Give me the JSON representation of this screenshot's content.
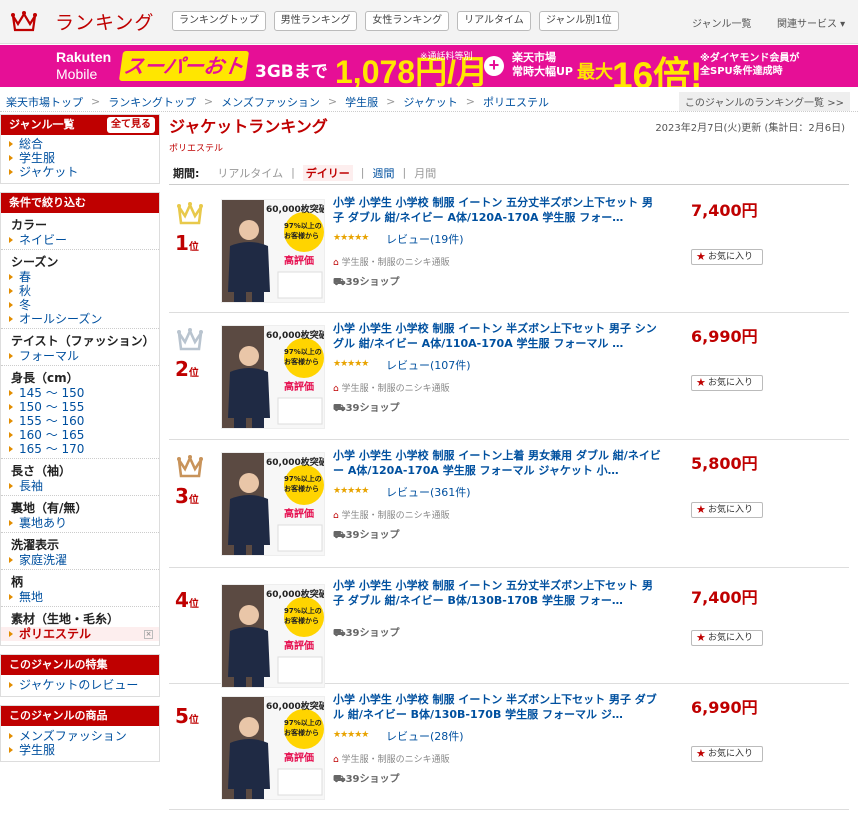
{
  "header": {
    "title": "ランキング",
    "nav": [
      "ランキングトップ",
      "男性ランキング",
      "女性ランキング",
      "リアルタイム",
      "ジャンル別1位"
    ],
    "genre_list": "ジャンル一覧",
    "services": "関連サービス ▾"
  },
  "banner": {
    "brand": "Rakuten",
    "brand2": "Mobile",
    "campaign": "スーパーおトク",
    "data": "3GBまで",
    "price": "1,078円/月",
    "note": "※通話料等別",
    "ichiba1": "楽天市場",
    "ichiba2": "常時大幅UP",
    "max": "最大",
    "mult": "16倍!",
    "dia1": "※ダイヤモンド会員が",
    "dia2": "全SPU条件達成時"
  },
  "breadcrumb": {
    "items": [
      "楽天市場トップ",
      "ランキングトップ",
      "メンズファッション",
      "学生服",
      "ジャケット",
      "ポリエステル"
    ],
    "list_link": "このジャンルのランキング一覧 >>"
  },
  "sidebar": {
    "genre_head": "ジャンル一覧",
    "all_button": "全て見る",
    "genres": [
      "総合",
      "学生服",
      "ジャケット"
    ],
    "filter_head": "条件で絞り込む",
    "filters": [
      {
        "name": "カラー",
        "items": [
          "ネイビー"
        ]
      },
      {
        "name": "シーズン",
        "items": [
          "春",
          "秋",
          "冬",
          "オールシーズン"
        ]
      },
      {
        "name": "テイスト（ファッション）",
        "items": [
          "フォーマル"
        ]
      },
      {
        "name": "身長（cm）",
        "items": [
          "145 ～ 150",
          "150 ～ 155",
          "155 ～ 160",
          "160 ～ 165",
          "165 ～ 170"
        ]
      },
      {
        "name": "長さ（袖）",
        "items": [
          "長袖"
        ]
      },
      {
        "name": "裏地（有/無）",
        "items": [
          "裏地あり"
        ]
      },
      {
        "name": "洗濯表示",
        "items": [
          "家庭洗濯"
        ]
      },
      {
        "name": "柄",
        "items": [
          "無地"
        ]
      },
      {
        "name": "素材（生地・毛糸）",
        "items": [
          "ポリエステル"
        ]
      }
    ],
    "feature_head": "このジャンルの特集",
    "feature": "ジャケットのレビュー",
    "products_head": "このジャンルの商品",
    "products": [
      "メンズファッション",
      "学生服"
    ]
  },
  "main": {
    "title": "ジャケットランキング",
    "subtitle": "ポリエステル",
    "updated": "2023年2月7日(火)更新 (集計日：2月6日)",
    "period_label": "期間:",
    "periods": [
      "リアルタイム",
      "デイリー",
      "週間",
      "月間"
    ],
    "current_period": "デイリー"
  },
  "items": [
    {
      "rank": "1",
      "rank_unit": "位",
      "title": "小学 小学生 小学校 制服 イートン 五分丈半ズボン上下セット 男子 ダブル 紺/ネイビー A体/120A-170A 学生服 フォー…",
      "price": "7,400円",
      "reviews": "レビュー(19件)",
      "shop": "学生服・制服のニシキ通販",
      "ship": "39ショップ",
      "fav": "お気に入り",
      "color": "#e8c94b"
    },
    {
      "rank": "2",
      "rank_unit": "位",
      "title": "小学 小学生 小学校 制服 イートン 半ズボン上下セット 男子 シングル 紺/ネイビー A体/110A-170A 学生服 フォーマル …",
      "price": "6,990円",
      "reviews": "レビュー(107件)",
      "shop": "学生服・制服のニシキ通販",
      "ship": "39ショップ",
      "fav": "お気に入り",
      "color": "#b9c4cf"
    },
    {
      "rank": "3",
      "rank_unit": "位",
      "title": "小学 小学生 小学校 制服 イートン上着 男女兼用 ダブル 紺/ネイビー A体/120A-170A 学生服 フォーマル ジャケット 小…",
      "price": "5,800円",
      "reviews": "レビュー(361件)",
      "shop": "学生服・制服のニシキ通販",
      "ship": "39ショップ",
      "fav": "お気に入り",
      "color": "#c8935a"
    },
    {
      "rank": "4",
      "rank_unit": "位",
      "title": "小学 小学生 小学校 制服 イートン 五分丈半ズボン上下セット 男子 ダブル 紺/ネイビー B体/130B-170B 学生服 フォー…",
      "price": "7,400円",
      "reviews": "",
      "shop": "",
      "ship": "39ショップ",
      "fav": "お気に入り",
      "color": ""
    },
    {
      "rank": "5",
      "rank_unit": "位",
      "title": "小学 小学生 小学校 制服 イートン 半ズボン上下セット 男子 ダブル 紺/ネイビー B体/130B-170B 学生服 フォーマル ジ…",
      "price": "6,990円",
      "reviews": "レビュー(28件)",
      "shop": "学生服・制服のニシキ通販",
      "ship": "39ショップ",
      "fav": "お気に入り",
      "color": ""
    }
  ],
  "thumb": {
    "sold": "60,000枚突破",
    "line1": "97%以上の",
    "line2": "お客様から",
    "rate": "高評価"
  }
}
